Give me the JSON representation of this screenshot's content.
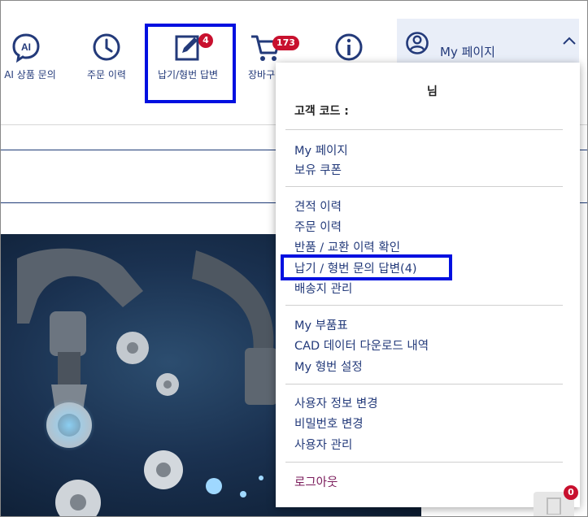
{
  "nav": {
    "ai_inquiry": "AI 상품 문의",
    "order_history": "주문 이력",
    "answers": "납기/형번 답변",
    "answers_badge": "4",
    "cart": "장바구니",
    "cart_badge": "173",
    "info_icon": "info-icon"
  },
  "mypage": {
    "label": "My 페이지"
  },
  "dropdown": {
    "user_suffix": "님",
    "customer_code_label": "고객 코드 :",
    "groups": [
      [
        "My 페이지",
        "보유 쿠폰"
      ],
      [
        "견적 이력",
        "주문 이력",
        "반품 / 교환 이력 확인",
        "납기 / 형번 문의 답변(4)",
        "배송지 관리"
      ],
      [
        "My 부품표",
        "CAD 데이터 다운로드 내역",
        "My 형번 설정"
      ],
      [
        "사용자 정보 변경",
        "비밀번호 변경",
        "사용자 관리"
      ]
    ],
    "logout": "로그아웃"
  },
  "float_badge": "0",
  "colors": {
    "navy": "#233a7a",
    "badge_red": "#c8102e",
    "highlight_blue": "#0010e0"
  }
}
